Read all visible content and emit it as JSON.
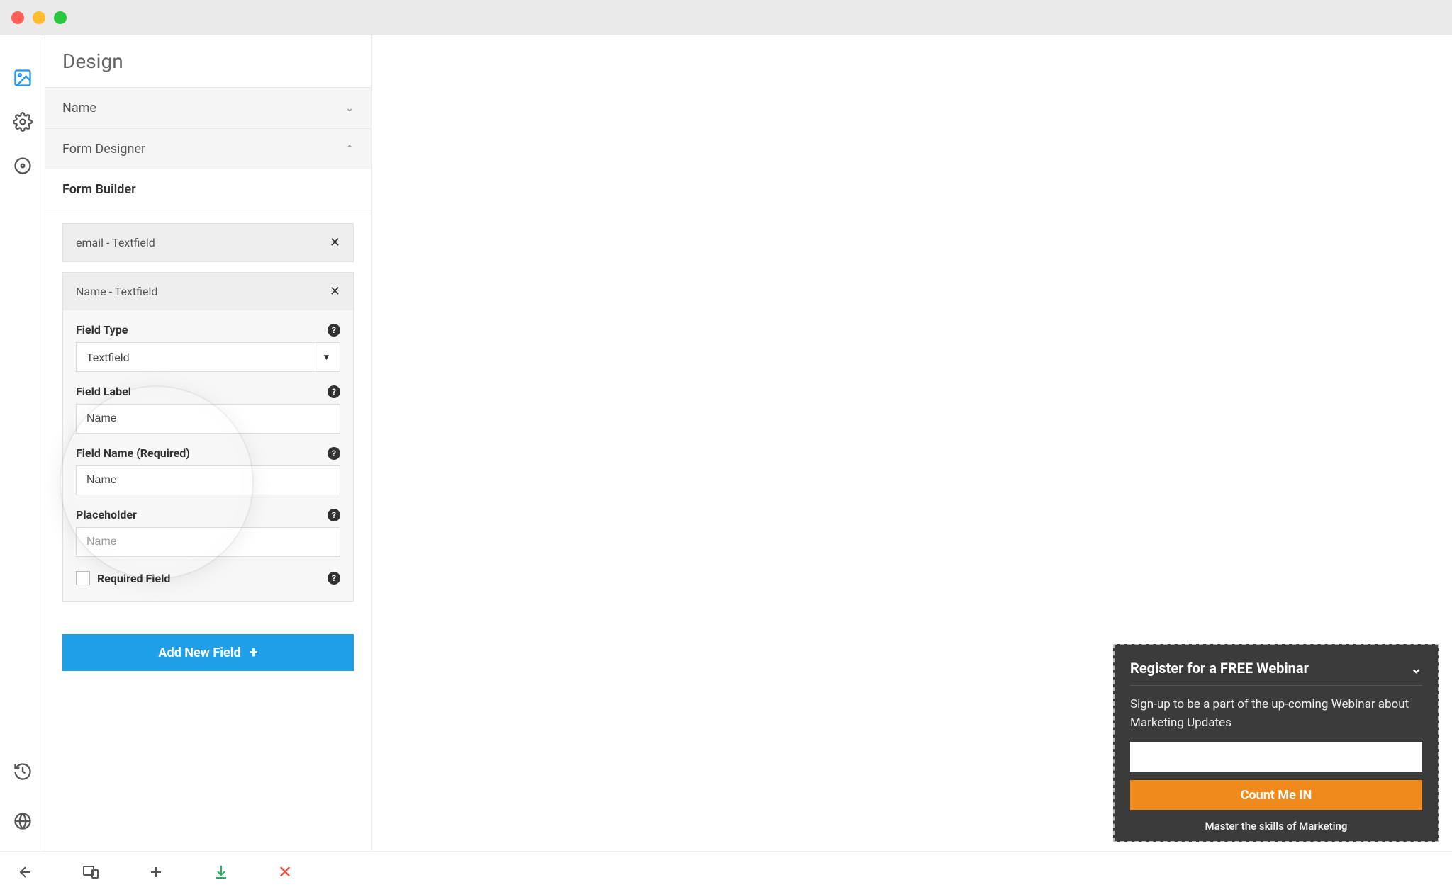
{
  "panel": {
    "title": "Design",
    "sections": {
      "name": {
        "label": "Name",
        "expanded": false
      },
      "formDesigner": {
        "label": "Form Designer",
        "expanded": true
      }
    },
    "formBuilder": {
      "label": "Form Builder",
      "fields": [
        {
          "label": "email - Textfield"
        },
        {
          "label": "Name - Textfield"
        }
      ],
      "editor": {
        "fieldTypeLabel": "Field Type",
        "fieldTypeValue": "Textfield",
        "fieldLabelLabel": "Field Label",
        "fieldLabelValue": "Name",
        "fieldNameLabel": "Field Name (Required)",
        "fieldNameValue": "Name",
        "placeholderLabel": "Placeholder",
        "placeholderValue": "Name",
        "requiredLabel": "Required Field"
      },
      "addButton": "Add New Field"
    }
  },
  "popup": {
    "title": "Register for a FREE Webinar",
    "body": "Sign-up to be a part of the up-coming Webinar about Marketing Updates",
    "cta": "Count Me IN",
    "foot": "Master the skills of Marketing"
  }
}
